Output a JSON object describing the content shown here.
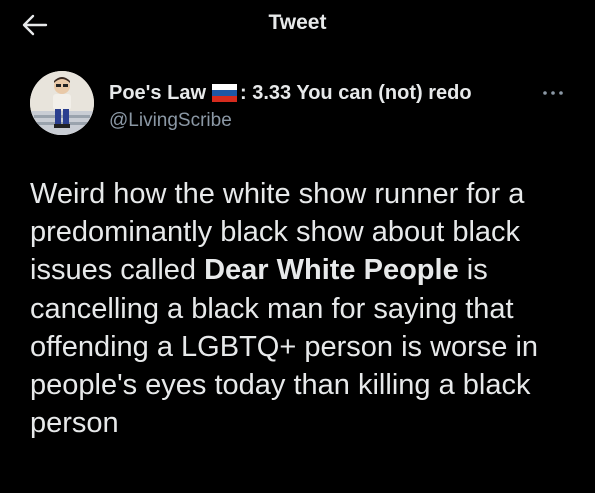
{
  "header": {
    "title": "Tweet",
    "back_icon": "arrow-left-icon"
  },
  "author": {
    "name": "Poe's Law",
    "flag_icon": "russia-flag-icon",
    "name_suffix": ": 3.33 You can (not) redo",
    "handle": "@LivingScribe",
    "avatar_icon": "cartoon-avatar",
    "more_icon": "more-horizontal-icon"
  },
  "tweet": {
    "text_part1": "Weird how the white show runner for a predominantly black show about black issues called ",
    "text_bold": "Dear White People",
    "text_part2": " is cancelling a black man for saying that offending a LGBTQ+ person is worse in people's eyes today than killing a black person"
  },
  "colors": {
    "background": "#000000",
    "text_primary": "#e7e9ea",
    "text_secondary": "#8b98a5"
  }
}
